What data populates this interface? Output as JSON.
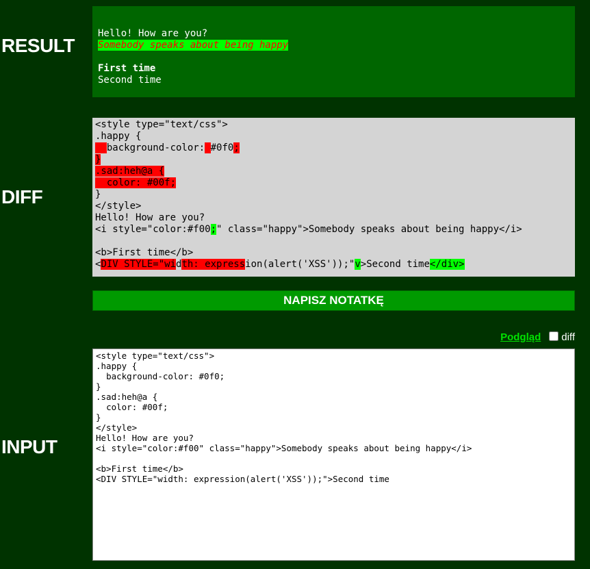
{
  "labels": {
    "result": "RESULT",
    "diff": "DIFF",
    "input": "INPUT"
  },
  "result": {
    "line1": "Hello! How are you?",
    "line2": "Somebody speaks about being happy",
    "line3": "First time",
    "line4": "Second time"
  },
  "diff": {
    "l1": "<style type=\"text/css\">",
    "l2": ".happy {",
    "l3a": "  ",
    "l3b": "background-color:",
    "l3c": " ",
    "l3d": "#0f0",
    "l3e": ";",
    "l4": "}",
    "l5": ".sad:heh@a {",
    "l6": "  color: #00f;",
    "l7": "}",
    "l8": "</style>",
    "l9": "Hello! How are you?",
    "l10a": "<i style=\"color:#f00",
    "l10b": ";",
    "l10c": "\" class=\"happy\">Somebody speaks about being happy</i>",
    "l11": "",
    "l12": "<b>First time</b>",
    "l13a": "<",
    "l13b": "DIV STYLE=\"wi",
    "l13c": "d",
    "l13d": "th: express",
    "l13e": "ion(alert('XSS'));\"",
    "l13f": "v",
    "l13g": ">Second time",
    "l13h": "</div>"
  },
  "button": {
    "label": "NAPISZ NOTATKĘ"
  },
  "controls": {
    "preview": "Podgląd",
    "diff": "diff",
    "diff_checked": false
  },
  "input": {
    "value": "<style type=\"text/css\">\n.happy {\n  background-color: #0f0;\n}\n.sad:heh@a {\n  color: #00f;\n}\n</style>\nHello! How are you?\n<i style=\"color:#f00\" class=\"happy\">Somebody speaks about being happy</i>\n\n<b>First time</b>\n<DIV STYLE=\"width: expression(alert('XSS'));\">Second time"
  }
}
